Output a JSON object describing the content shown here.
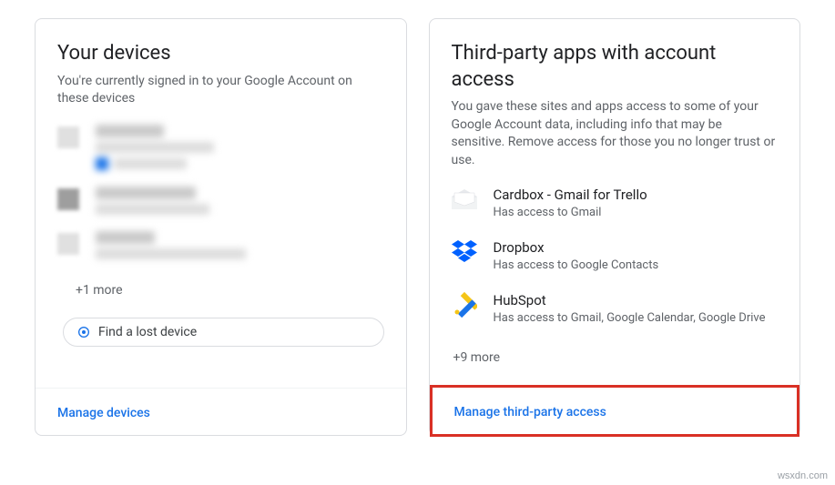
{
  "devices_card": {
    "title": "Your devices",
    "desc": "You're currently signed in to your Google Account on these devices",
    "more": "+1 more",
    "find_label": "Find a lost device",
    "manage_label": "Manage devices"
  },
  "apps_card": {
    "title": "Third-party apps with account access",
    "desc": "You gave these sites and apps access to some of your Google Account data, including info that may be sensitive. Remove access for those you no longer trust or use.",
    "apps": [
      {
        "name": "Cardbox - Gmail for Trello",
        "access": "Has access to Gmail"
      },
      {
        "name": "Dropbox",
        "access": "Has access to Google Contacts"
      },
      {
        "name": "HubSpot",
        "access": "Has access to Gmail, Google Calendar, Google Drive"
      }
    ],
    "more": "+9 more",
    "manage_label": "Manage third-party access"
  },
  "watermark": "wsxdn.com"
}
